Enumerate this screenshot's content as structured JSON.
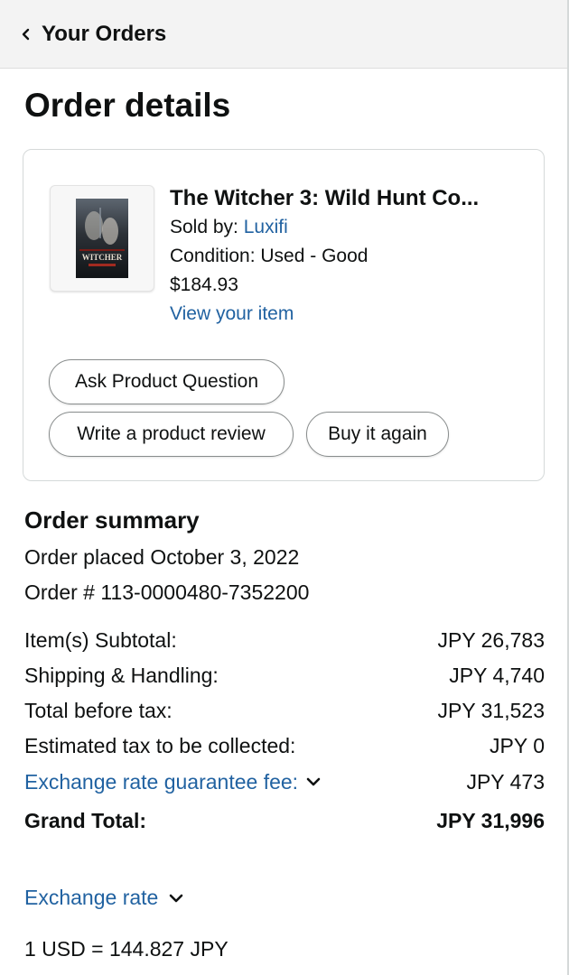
{
  "header": {
    "back_label": "Your Orders"
  },
  "page_title": "Order details",
  "item": {
    "title": "The Witcher 3: Wild Hunt Co...",
    "sold_by_prefix": "Sold by: ",
    "seller": "Luxifi",
    "condition": "Condition: Used - Good",
    "price": "$184.93",
    "view_link": "View your item",
    "cover_text": "WITCHER"
  },
  "actions": {
    "ask_question": "Ask Product Question",
    "write_review": "Write a product review",
    "buy_again": "Buy it again"
  },
  "summary": {
    "heading": "Order summary",
    "placed": "Order placed October 3, 2022",
    "order_number": "Order # 113-0000480-7352200",
    "rows": [
      {
        "label": "Item(s) Subtotal:",
        "value": "JPY 26,783"
      },
      {
        "label": "Shipping & Handling:",
        "value": "JPY 4,740"
      },
      {
        "label": "Total before tax:",
        "value": "JPY 31,523"
      },
      {
        "label": "Estimated tax to be collected:",
        "value": "JPY 0"
      },
      {
        "label": "Exchange rate guarantee fee:",
        "value": "JPY 473"
      },
      {
        "label": "Grand Total:",
        "value": "JPY 31,996"
      }
    ]
  },
  "exchange_rate": {
    "label": "Exchange rate",
    "value": "1 USD = 144.827 JPY"
  },
  "colors": {
    "link": "#2162a1",
    "text": "#0f1111",
    "header_bg": "#f3f3f3"
  },
  "icons": [
    "chevron-left-icon",
    "chevron-down-icon",
    "product-thumbnail"
  ]
}
